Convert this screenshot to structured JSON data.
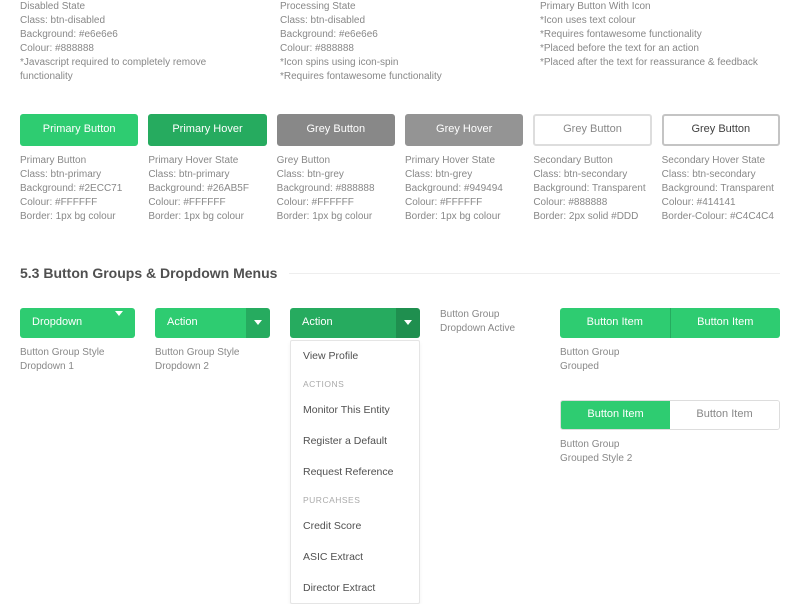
{
  "top_descriptions": [
    {
      "title": "Disabled State",
      "lines": [
        "Class: btn-disabled",
        "Background: #e6e6e6",
        "Colour: #888888",
        "*Javascript required to completely remove functionality"
      ]
    },
    {
      "title": "Processing State",
      "lines": [
        "Class: btn-disabled",
        "Background: #e6e6e6",
        "Colour: #888888",
        "*Icon spins using icon-spin",
        "*Requires fontawesome functionality"
      ]
    },
    {
      "title": "Primary Button With Icon",
      "lines": [
        "*Icon uses text colour",
        "*Requires fontawesome functionality",
        "*Placed before the text for an action",
        "*Placed after the text for reassurance & feedback"
      ]
    }
  ],
  "buttons": [
    {
      "label": "Primary Button",
      "desc_title": "Primary Button",
      "desc": [
        "Class: btn-primary",
        "Background: #2ECC71",
        "Colour: #FFFFFF",
        "Border: 1px bg colour"
      ],
      "css": "btn-primary"
    },
    {
      "label": "Primary Hover",
      "desc_title": "Primary Hover State",
      "desc": [
        "Class: btn-primary",
        "Background: #26AB5F",
        "Colour: #FFFFFF",
        "Border: 1px bg colour"
      ],
      "css": "btn-primary-hover"
    },
    {
      "label": "Grey Button",
      "desc_title": "Grey Button",
      "desc": [
        "Class: btn-grey",
        "Background: #888888",
        "Colour: #FFFFFF",
        "Border: 1px bg colour"
      ],
      "css": "btn-grey"
    },
    {
      "label": "Grey Hover",
      "desc_title": "Primary Hover State",
      "desc": [
        "Class: btn-grey",
        "Background: #949494",
        "Colour: #FFFFFF",
        "Border: 1px bg colour"
      ],
      "css": "btn-grey-hover"
    },
    {
      "label": "Grey Button",
      "desc_title": "Secondary Button",
      "desc": [
        "Class: btn-secondary",
        "Background: Transparent",
        "Colour: #888888",
        "Border: 2px solid #DDD"
      ],
      "css": "btn-secondary"
    },
    {
      "label": "Grey Button",
      "desc_title": "Secondary Hover State",
      "desc": [
        "Class: btn-secondary",
        "Background: Transparent",
        "Colour: #414141",
        "Border-Colour: #C4C4C4"
      ],
      "css": "btn-secondary-hover"
    }
  ],
  "section_title": "5.3 Button Groups & Dropdown Menus",
  "dd1": {
    "label": "Dropdown",
    "caption1": "Button Group Style",
    "caption2": "Dropdown 1"
  },
  "dd2": {
    "label": "Action",
    "caption1": "Button Group Style",
    "caption2": "Dropdown 2"
  },
  "dd3": {
    "label": "Action",
    "caption1": "Button Group",
    "caption2": "Dropdown Active",
    "menu": {
      "view": "View Profile",
      "h1": "ACTIONS",
      "a1": "Monitor This Entity",
      "a2": "Register a Default",
      "a3": "Request Reference",
      "h2": "PURCAHSES",
      "p1": "Credit Score",
      "p2": "ASIC Extract",
      "p3": "Director Extract"
    }
  },
  "group1": {
    "item": "Button Item",
    "caption1": "Button Group",
    "caption2": "Grouped"
  },
  "group2": {
    "item": "Button Item",
    "caption1": "Button Group",
    "caption2": "Grouped Style 2"
  }
}
